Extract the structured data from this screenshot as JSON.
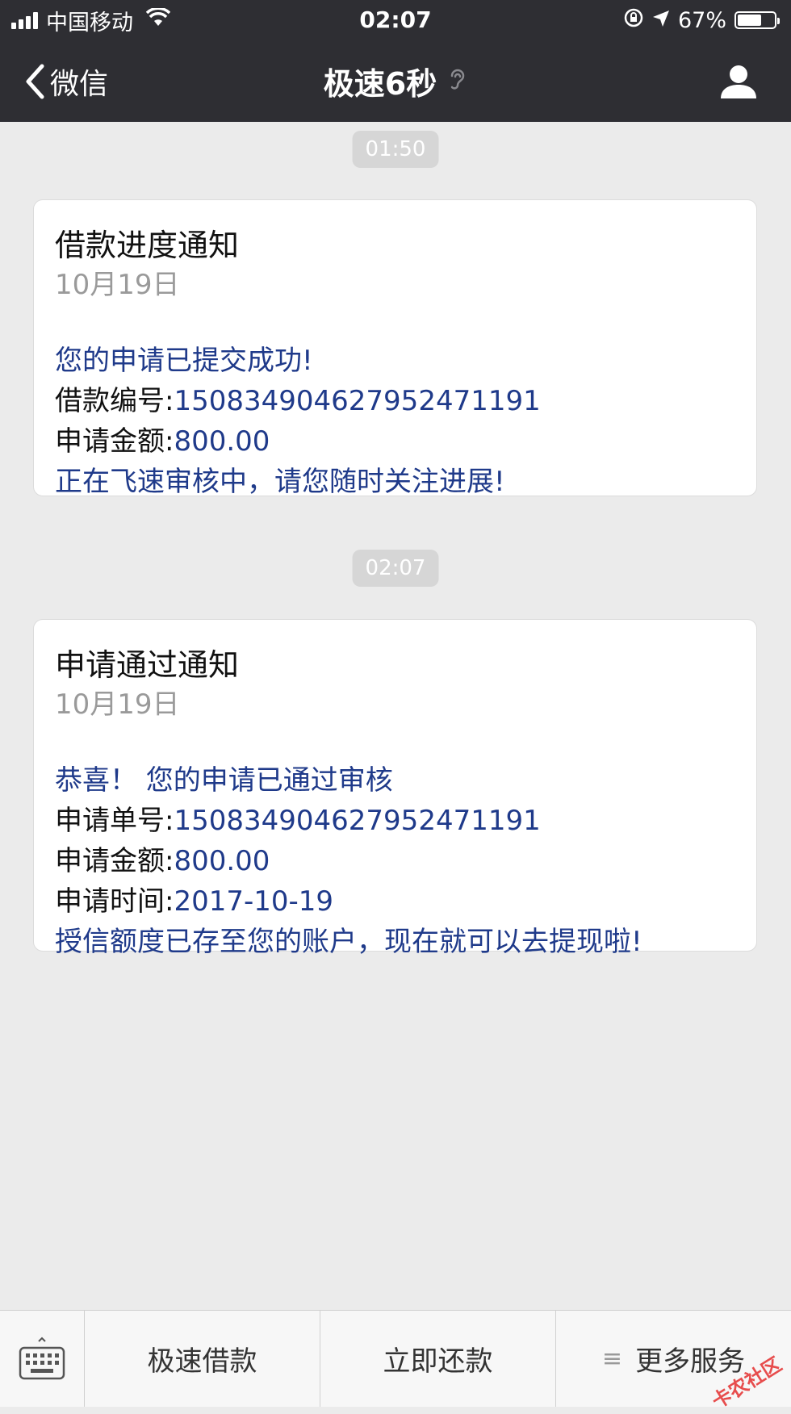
{
  "status_bar": {
    "carrier": "中国移动",
    "time": "02:07",
    "battery_percent": "67%",
    "battery_level": 0.67
  },
  "nav": {
    "back_label": "微信",
    "title": "极速6秒"
  },
  "messages": [
    {
      "timestamp": "01:50",
      "title": "借款进度通知",
      "date": "10月19日",
      "lines": [
        {
          "label": "",
          "value": "您的申请已提交成功!"
        },
        {
          "label": "借款编号:",
          "value": "150834904627952471191"
        },
        {
          "label": "申请金额:",
          "value": "800.00"
        },
        {
          "label": "",
          "value": "正在飞速审核中，请您随时关注进展!"
        }
      ]
    },
    {
      "timestamp": "02:07",
      "title": "申请通过通知",
      "date": "10月19日",
      "lines": [
        {
          "label": "",
          "value": "恭喜！ 您的申请已通过审核"
        },
        {
          "label": "申请单号:",
          "value": "150834904627952471191"
        },
        {
          "label": "申请金额:",
          "value": "800.00"
        },
        {
          "label": "申请时间:",
          "value": "2017-10-19"
        },
        {
          "label": "",
          "value": "授信额度已存至您的账户，现在就可以去提现啦!"
        }
      ]
    }
  ],
  "menu": {
    "items": [
      {
        "label": "极速借款"
      },
      {
        "label": "立即还款"
      },
      {
        "label": "更多服务"
      }
    ]
  },
  "watermark": "卡农社区",
  "colors": {
    "header_bg": "#2e2e33",
    "chat_bg": "#ebebeb",
    "message_blue": "#1f3a8a"
  }
}
